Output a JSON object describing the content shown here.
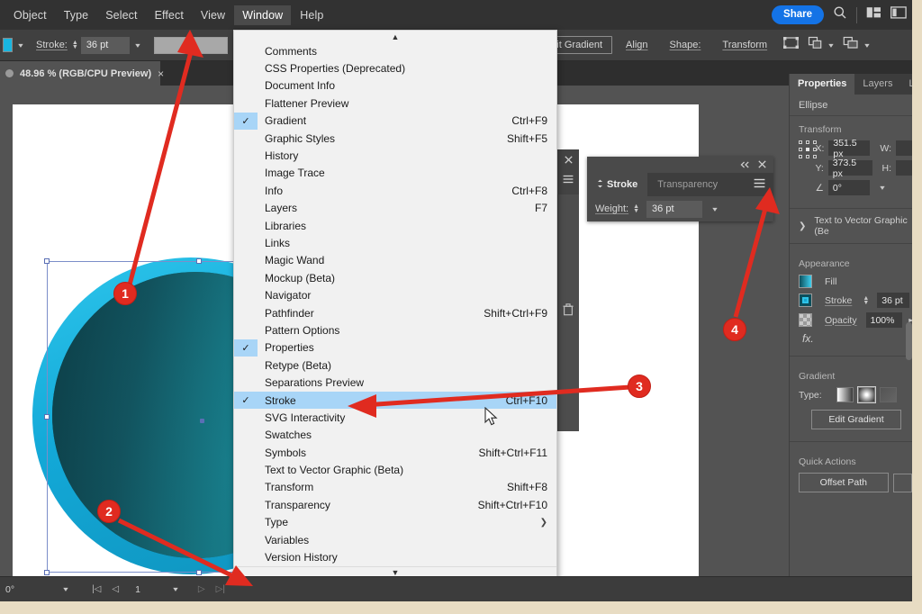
{
  "app": {
    "name": "Adobe Illustrator"
  },
  "menubar": {
    "items": [
      {
        "label": "Object",
        "active": false
      },
      {
        "label": "Type",
        "active": false
      },
      {
        "label": "Select",
        "active": false
      },
      {
        "label": "Effect",
        "active": false
      },
      {
        "label": "View",
        "active": false
      },
      {
        "label": "Window",
        "active": true
      },
      {
        "label": "Help",
        "active": false
      }
    ],
    "share_label": "Share",
    "icons": [
      "search-icon",
      "arrange-documents-icon",
      "workspace-switcher-icon"
    ]
  },
  "controlbar": {
    "stroke_label": "Stroke:",
    "stroke_weight": "36 pt",
    "edit_gradient_label": "Edit Gradient",
    "align_label": "Align",
    "shape_label": "Shape:",
    "transform_label": "Transform",
    "icons": [
      "select-all-icon",
      "arrange-icon",
      "align-icon"
    ]
  },
  "document_tab": {
    "title": "48.96 % (RGB/CPU Preview)",
    "close_label": "×"
  },
  "window_menu": {
    "scroll_up": "▲",
    "scroll_down": "▼",
    "items": [
      {
        "label": "Comments",
        "shortcut": "",
        "checked": false
      },
      {
        "label": "CSS Properties (Deprecated)",
        "shortcut": "",
        "checked": false
      },
      {
        "label": "Document Info",
        "shortcut": "",
        "checked": false
      },
      {
        "label": "Flattener Preview",
        "shortcut": "",
        "checked": false
      },
      {
        "label": "Gradient",
        "shortcut": "Ctrl+F9",
        "checked": true
      },
      {
        "label": "Graphic Styles",
        "shortcut": "Shift+F5",
        "checked": false
      },
      {
        "label": "History",
        "shortcut": "",
        "checked": false
      },
      {
        "label": "Image Trace",
        "shortcut": "",
        "checked": false
      },
      {
        "label": "Info",
        "shortcut": "Ctrl+F8",
        "checked": false
      },
      {
        "label": "Layers",
        "shortcut": "F7",
        "checked": false
      },
      {
        "label": "Libraries",
        "shortcut": "",
        "checked": false
      },
      {
        "label": "Links",
        "shortcut": "",
        "checked": false
      },
      {
        "label": "Magic Wand",
        "shortcut": "",
        "checked": false
      },
      {
        "label": "Mockup (Beta)",
        "shortcut": "",
        "checked": false
      },
      {
        "label": "Navigator",
        "shortcut": "",
        "checked": false
      },
      {
        "label": "Pathfinder",
        "shortcut": "Shift+Ctrl+F9",
        "checked": false
      },
      {
        "label": "Pattern Options",
        "shortcut": "",
        "checked": false
      },
      {
        "label": "Properties",
        "shortcut": "",
        "checked": true
      },
      {
        "label": "Retype (Beta)",
        "shortcut": "",
        "checked": false
      },
      {
        "label": "Separations Preview",
        "shortcut": "",
        "checked": false
      },
      {
        "label": "Stroke",
        "shortcut": "Ctrl+F10",
        "checked": true,
        "selected": true
      },
      {
        "label": "SVG Interactivity",
        "shortcut": "",
        "checked": false
      },
      {
        "label": "Swatches",
        "shortcut": "",
        "checked": false
      },
      {
        "label": "Symbols",
        "shortcut": "Shift+Ctrl+F11",
        "checked": false
      },
      {
        "label": "Text to Vector Graphic (Beta)",
        "shortcut": "",
        "checked": false
      },
      {
        "label": "Transform",
        "shortcut": "Shift+F8",
        "checked": false
      },
      {
        "label": "Transparency",
        "shortcut": "Shift+Ctrl+F10",
        "checked": false
      },
      {
        "label": "Type",
        "shortcut": "",
        "checked": false,
        "submenu": true
      },
      {
        "label": "Variables",
        "shortcut": "",
        "checked": false
      },
      {
        "label": "Version History",
        "shortcut": "",
        "checked": false
      }
    ]
  },
  "stroke_panel": {
    "tabs": [
      {
        "label": "Stroke",
        "selected": true
      },
      {
        "label": "Transparency",
        "selected": false
      }
    ],
    "weight_label": "Weight:",
    "weight_value": "36 pt",
    "icons": [
      "collapse-icon",
      "close-icon",
      "panel-menu-icon"
    ]
  },
  "mini_panel": {
    "icons": [
      "close-icon",
      "panel-menu-icon",
      "trash-icon"
    ]
  },
  "properties": {
    "tabs": [
      {
        "label": "Properties",
        "selected": true
      },
      {
        "label": "Layers",
        "selected": false
      },
      {
        "label": "Librar",
        "selected": false
      }
    ],
    "object_type": "Ellipse",
    "transform": {
      "title": "Transform",
      "x_label": "X:",
      "x_value": "351.5 px",
      "y_label": "Y:",
      "y_value": "373.5 px",
      "w_label": "W:",
      "w_value": "",
      "h_label": "H:",
      "h_value": "",
      "angle_label": "∠",
      "angle_value": "0°"
    },
    "text_to_vector": "Text to Vector Graphic (Be",
    "appearance": {
      "title": "Appearance",
      "fill_label": "Fill",
      "stroke_label": "Stroke",
      "stroke_value": "36 pt",
      "opacity_label": "Opacity",
      "opacity_value": "100%",
      "fx_label": "fx."
    },
    "gradient": {
      "title": "Gradient",
      "type_label": "Type:",
      "edit_label": "Edit Gradient",
      "types": [
        "linear-gradient-icon",
        "radial-gradient-icon",
        "freeform-gradient-icon"
      ]
    },
    "quick_actions": {
      "title": "Quick Actions",
      "offset_path": "Offset Path"
    }
  },
  "statusbar": {
    "angle": "0°",
    "page": "1",
    "icons": [
      "first-page-icon",
      "prev-page-icon",
      "next-page-icon",
      "last-page-icon"
    ]
  },
  "callouts": [
    {
      "number": "1"
    },
    {
      "number": "2"
    },
    {
      "number": "3"
    },
    {
      "number": "4"
    }
  ],
  "colors": {
    "accent_red": "#e02b20",
    "share_blue": "#1473e6",
    "menu_highlight": "#a8d5f7",
    "artwork_cyan": "#19b6e0",
    "artwork_teal": "#14626d"
  }
}
